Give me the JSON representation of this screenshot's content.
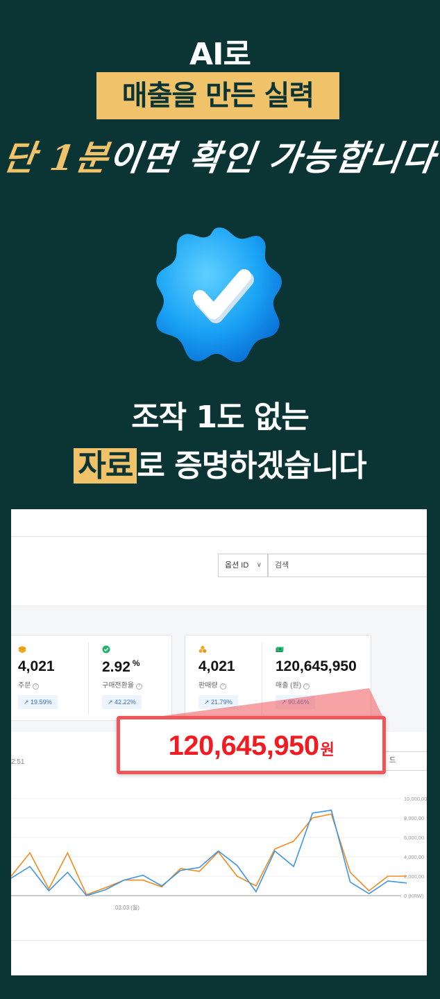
{
  "headline": {
    "line1": "AI로",
    "highlight": "매출을 만든 실력",
    "script_gold": "단 1분",
    "script_white": "이면 확인 가능합니다",
    "claim1": "조작 1도 없는",
    "claim2_highlight": "자료",
    "claim2_rest": "로 증명하겠습니다"
  },
  "badge": {
    "icon": "verified-check-badge-icon",
    "color": "#1aa3f5"
  },
  "dashboard": {
    "option_select": "옵션 ID",
    "search_placeholder": "검색",
    "metrics": [
      {
        "icon": "box-icon",
        "value": "4,021",
        "unit": "",
        "label": "주문",
        "change": "19.59%"
      },
      {
        "icon": "check-circle-icon",
        "value": "2.92",
        "unit": "%",
        "label": "구매전환율",
        "change": "42.22%"
      },
      {
        "icon": "coins-icon",
        "value": "4,021",
        "unit": "",
        "label": "판매량",
        "change": "21.79%"
      },
      {
        "icon": "cash-icon",
        "value": "120,645,950",
        "unit": "",
        "label": "매출 (원)",
        "change": "90.46%"
      }
    ],
    "timestamp": "2:51",
    "dropdown_label": "드"
  },
  "callout": {
    "amount": "120,645,950",
    "currency": "원"
  },
  "chart_data": {
    "type": "line",
    "x_tick_labels": [
      "03.03 (월)"
    ],
    "y_tick_labels": [
      "10,000,00",
      "8,000,00",
      "6,000,00",
      "4,000,00",
      "2,000,00",
      "0 (KRW)"
    ],
    "ylim": [
      0,
      10000000
    ],
    "grid": true,
    "series": [
      {
        "color": "#f08a1e",
        "values": [
          2000000,
          4400000,
          700000,
          4400000,
          100000,
          800000,
          1600000,
          1600000,
          900000,
          2800000,
          2500000,
          4500000,
          2000000,
          1000000,
          4800000,
          5600000,
          8000000,
          8400000,
          2400000,
          500000,
          2000000,
          2000000
        ]
      },
      {
        "color": "#3c95e8",
        "values": [
          1800000,
          3000000,
          500000,
          2400000,
          0,
          600000,
          1600000,
          2100000,
          1000000,
          2600000,
          2900000,
          4600000,
          3100000,
          400000,
          4600000,
          3000000,
          8500000,
          8800000,
          1400000,
          200000,
          1500000,
          1300000
        ]
      }
    ]
  },
  "colors": {
    "background": "#0b3434",
    "highlight": "#f0c26a",
    "callout_red": "#f01c22"
  }
}
